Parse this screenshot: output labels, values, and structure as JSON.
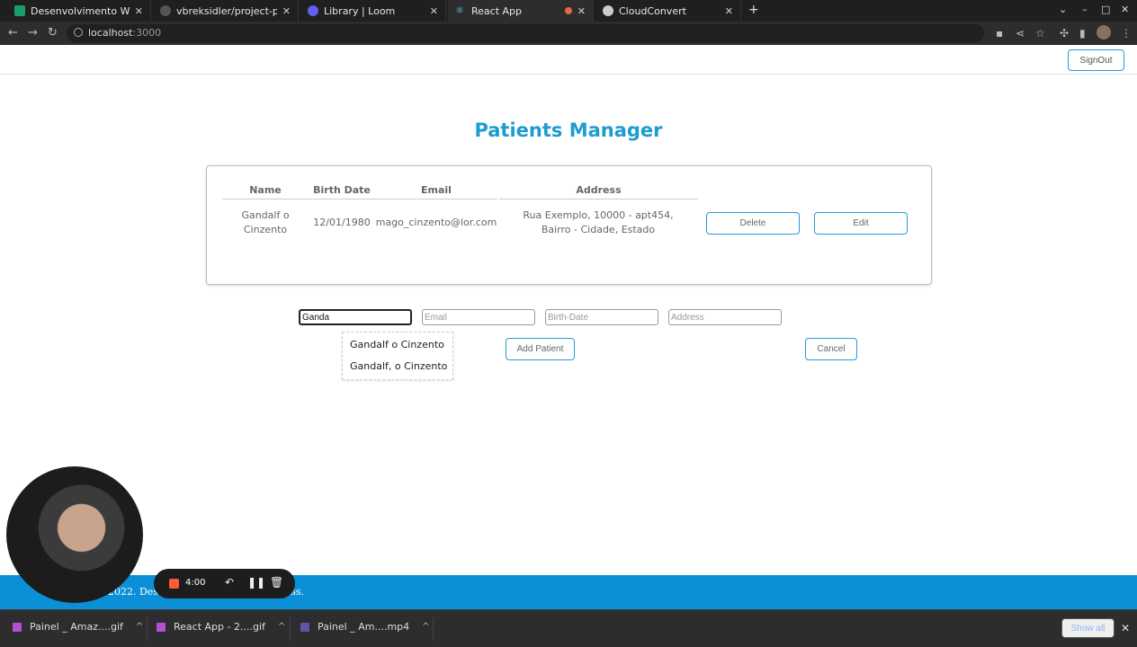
{
  "browser": {
    "tabs": [
      {
        "title": "Desenvolvimento Web - T",
        "color": "#1a9d6a"
      },
      {
        "title": "vbreksidler/project-patie",
        "color": "#555555"
      },
      {
        "title": "Library | Loom",
        "color": "#625df5"
      },
      {
        "title": "React App",
        "color": "#61dafb"
      },
      {
        "title": "CloudConvert",
        "color": "#cccccc"
      }
    ],
    "url_host": "localhost",
    "url_port": ":3000"
  },
  "header": {
    "signout_label": "SignOut"
  },
  "main": {
    "title": "Patients Manager",
    "table": {
      "columns": [
        "Name",
        "Birth Date",
        "Email",
        "Address"
      ],
      "rows": [
        {
          "name": "Gandalf o Cinzento",
          "birth_date": "12/01/1980",
          "email": "mago_cinzento@lor.com",
          "address": "Rua Exemplo, 10000 - apt454, Bairro - Cidade, Estado",
          "delete_label": "Delete",
          "edit_label": "Edit"
        }
      ]
    },
    "form": {
      "name_value": "Ganda",
      "email_placeholder": "Email",
      "birth_placeholder": "Birth-Date",
      "address_placeholder": "Address",
      "add_label": "Add Patient",
      "cancel_label": "Cancel",
      "suggestions": [
        "Gandalf o Cinzento",
        "Gandalf, o Cinzento"
      ]
    }
  },
  "footer": {
    "text": "2022. Dese                                        act, e estilização com Sass."
  },
  "loom": {
    "time": "4:00"
  },
  "downloads": {
    "items": [
      "Painel _ Amaz....gif",
      "React App - 2....gif",
      "Painel _ Am....mp4"
    ],
    "show_all_label": "Show all"
  }
}
